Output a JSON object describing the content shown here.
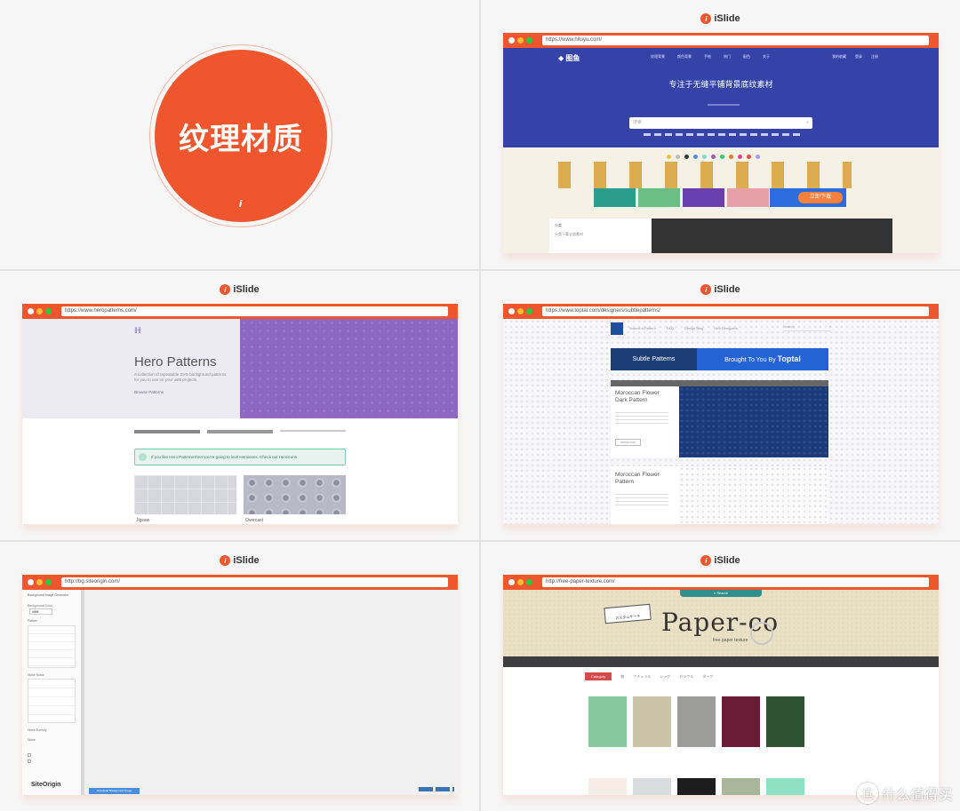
{
  "panel1": {
    "title": "纹理材质",
    "mark": "i"
  },
  "brand": {
    "name": "iSlide",
    "mark": "i"
  },
  "panel2": {
    "url": "https://www.hituyu.com/",
    "site_name": "图鱼",
    "nav": [
      "纹理背景",
      "颜色背景",
      "手绘",
      "热门",
      "配色",
      "关于"
    ],
    "nav_right": [
      "我的收藏",
      "登录",
      "注册"
    ],
    "headline": "专注于无缝平铺背景底纹素材",
    "search_placeholder": "搜索",
    "cta": "立即下载",
    "list_title": "分类",
    "list_sub": "分类下载全部素材"
  },
  "panel3": {
    "url": "https://www.heropatterns.com/",
    "title": "Hero Patterns",
    "subtitle": "A collection of repeatable SVG background patterns for you to use on your web projects.",
    "browse": "Browse Patterns",
    "banner": "If you like Hero Patterns then you're going to love Heroicons. Check out Heroicons",
    "patterns": [
      "Jigsaw",
      "Overcast"
    ]
  },
  "panel4": {
    "url": "https://www.toptal.com/designers/subtlepatterns/",
    "nav": [
      "Submit a Pattern",
      "FAQ",
      "Design Blog",
      "Hire Designers"
    ],
    "search": "Search",
    "band_left": "Subtle Patterns",
    "band_right": "Brought To You By",
    "band_brand": "Toptal",
    "items": [
      {
        "title": "Moroccan Flower Dark Pattern",
        "download": "DOWNLOAD"
      },
      {
        "title": "Moroccan Flower Pattern",
        "download": ""
      }
    ]
  },
  "panel5": {
    "url": "http://bg.siteorigin.com/",
    "sidebar_title": "Background Image Generator",
    "fields": [
      "Background Color",
      "Pattern",
      "Noise Noise",
      "Noise Density",
      "Noise"
    ],
    "color_value": "#ffffff",
    "footer_logo": "SiteOrigin",
    "download_button": "Download Background Image"
  },
  "panel6": {
    "url": "http://free-paper-texture.com/",
    "search": "Search",
    "logo": "Paper-co",
    "tagline": "free paper texture",
    "stamp": "カスタムサーチ",
    "category_label": "Category",
    "categories": [
      "和",
      "ナチュラル",
      "シック",
      "カラフル",
      "ダーク"
    ],
    "swatches": [
      "#86c79f",
      "#c9c4a8",
      "#9c9c9a",
      "#6a1c36",
      "#2f5232"
    ]
  },
  "watermark": {
    "text": "什么值得买"
  }
}
